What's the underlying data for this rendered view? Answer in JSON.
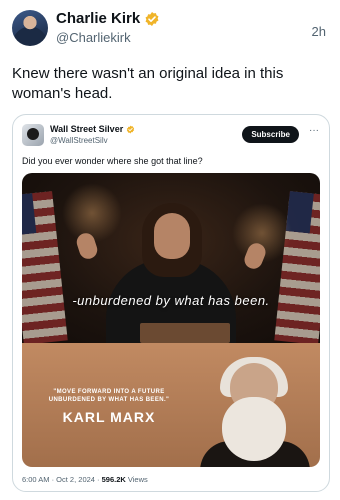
{
  "post": {
    "author_name": "Charlie Kirk",
    "handle": "@Charliekirk",
    "time_ago": "2h",
    "text": "Knew there wasn't an original idea in this woman's head.",
    "verified_color": "#f0b429"
  },
  "quoted": {
    "author_name": "Wall Street Silver",
    "handle": "@WallStreetSilv",
    "subscribe_label": "Subscribe",
    "more_label": "···",
    "text": "Did you ever wonder where she got that line?",
    "media": {
      "overlay_caption": "-unburdened by what has been.",
      "quote_line_1": "\"MOVE FORWARD INTO A FUTURE",
      "quote_line_2": "UNBURDENED BY WHAT HAS BEEN.\"",
      "quote_author": "KARL MARX"
    },
    "meta": {
      "timestamp": "6:00 AM · Oct 2, 2024 · ",
      "views_count": "596.2K",
      "views_label": " Views"
    }
  }
}
